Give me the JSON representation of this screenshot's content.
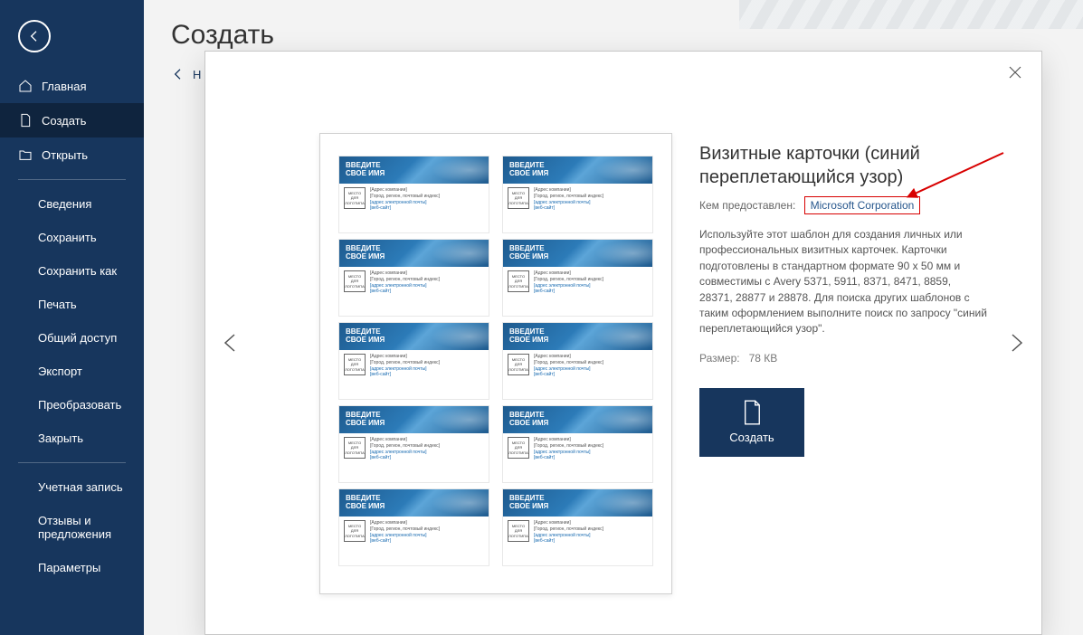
{
  "sidebar": {
    "nav": {
      "home": "Главная",
      "new": "Создать",
      "open": "Открыть"
    },
    "group1": {
      "info": "Сведения",
      "save": "Сохранить",
      "saveas": "Сохранить как",
      "print": "Печать",
      "share": "Общий доступ",
      "export": "Экспорт",
      "transform": "Преобразовать",
      "close": "Закрыть"
    },
    "group2": {
      "account": "Учетная запись",
      "feedback": "Отзывы и предложения",
      "options": "Параметры"
    }
  },
  "page": {
    "title": "Создать",
    "back": "Н"
  },
  "modal": {
    "title": "Визитные карточки (синий переплетающийся узор)",
    "provided_label": "Кем предоставлен:",
    "provider": "Microsoft Corporation",
    "description": "Используйте этот шаблон для создания личных или профессиональных визитных карточек. Карточки подготовлены в стандартном формате 90 x 50 мм и совместимы с Avery 5371, 5911, 8371, 8471, 8859, 28371, 28877 и 28878. Для поиска других шаблонов с таким оформлением выполните поиск по запросу \"синий переплетающийся узор\".",
    "size_label": "Размер:",
    "size_value": "78 КВ",
    "create": "Создать"
  },
  "card": {
    "name_line1": "ВВЕДИТЕ",
    "name_line2": "СВОЕ ИМЯ",
    "logo": "МЕСТО ДЛЯ ЛОГОТИПА",
    "addr1": "[Адрес компании]",
    "addr2": "[Город, регион, почтовый индекс]",
    "addr3": "[адрес электронной почты]",
    "addr4": "[веб-сайт]"
  }
}
